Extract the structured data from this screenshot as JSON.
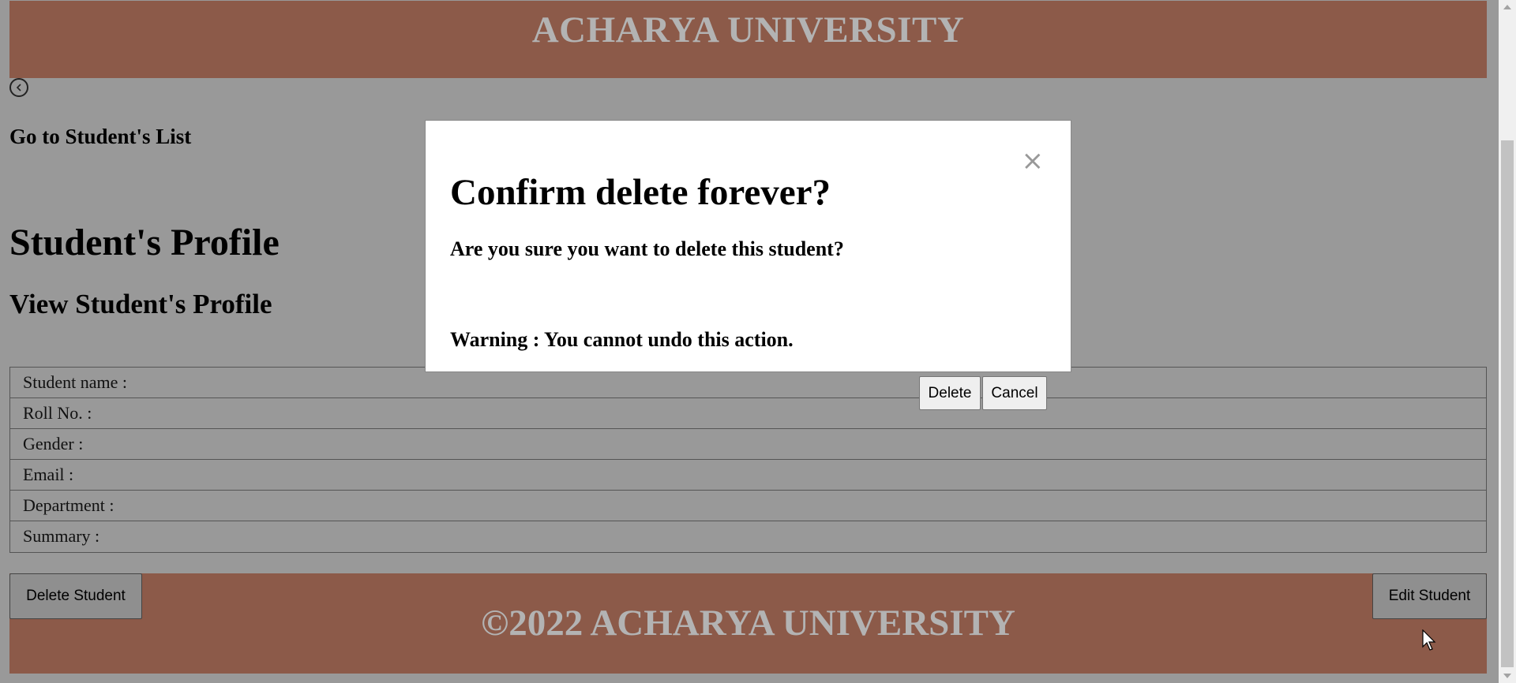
{
  "header": {
    "title": "ACHARYA UNIVERSITY"
  },
  "nav": {
    "back_icon": "chevron-left-circle-icon",
    "go_to_list": "Go to Student's List"
  },
  "profile": {
    "title": "Student's Profile",
    "subtitle": "View Student's Profile",
    "fields": [
      {
        "label": "Student name :",
        "value": ""
      },
      {
        "label": "Roll No. :",
        "value": ""
      },
      {
        "label": "Gender :",
        "value": ""
      },
      {
        "label": "Email :",
        "value": ""
      },
      {
        "label": "Department :",
        "value": ""
      },
      {
        "label": "Summary :",
        "value": ""
      }
    ]
  },
  "actions": {
    "delete_student": "Delete Student",
    "edit_student": "Edit Student"
  },
  "footer": {
    "text": "©2022 ACHARYA UNIVERSITY"
  },
  "modal": {
    "title": "Confirm delete forever?",
    "message": "Are you sure you want to delete this student?",
    "warning": "Warning : You cannot undo this action.",
    "close_icon": "close-icon",
    "close_glyph": "×",
    "delete_label": "Delete",
    "cancel_label": "Cancel"
  },
  "colors": {
    "overlay": "#999999",
    "brand": "#8c5a49",
    "brand_text": "#b3b3b3"
  }
}
